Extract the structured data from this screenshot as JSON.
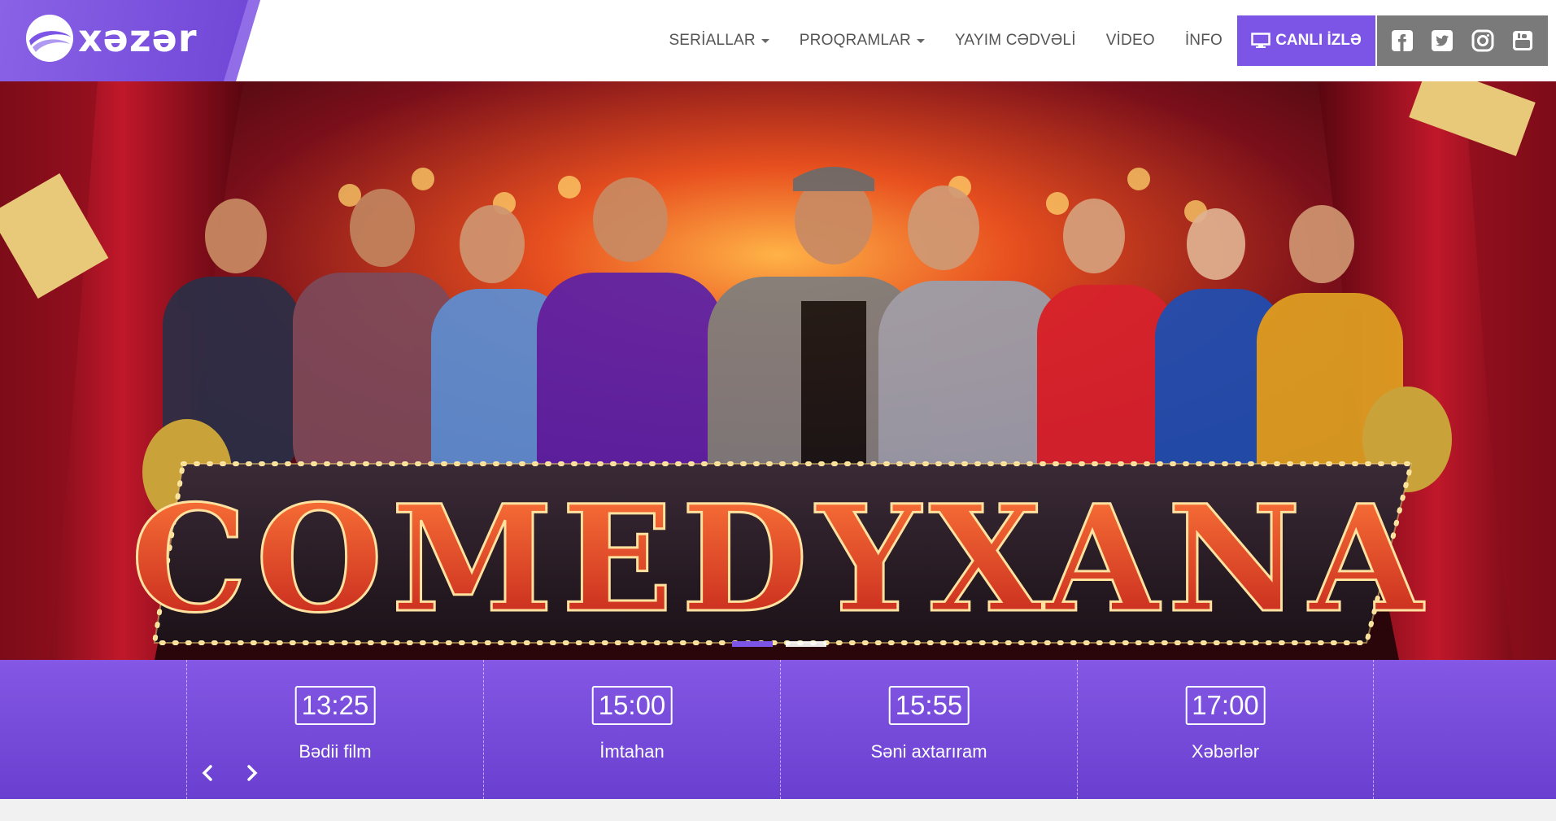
{
  "brand": {
    "name": "xəzər",
    "logo_icon": "xezer-logo-icon",
    "primary_color": "#7c55e6"
  },
  "nav": {
    "items": [
      {
        "label": "SERİALLAR",
        "dropdown": true
      },
      {
        "label": "PROQRAMLAR",
        "dropdown": true
      },
      {
        "label": "YAYIM CƏDVƏLİ",
        "dropdown": false
      },
      {
        "label": "VİDEO",
        "dropdown": false
      },
      {
        "label": "İNFO",
        "dropdown": false
      }
    ],
    "live_button": "CANLI İZLƏ",
    "social": [
      "facebook-icon",
      "twitter-icon",
      "instagram-icon",
      "youtube-icon"
    ]
  },
  "hero": {
    "title": "COMEDYXANA",
    "slides_total": 2,
    "active_slide": 1
  },
  "schedule": {
    "items": [
      {
        "time": "13:25",
        "title": "Bədii film"
      },
      {
        "time": "15:00",
        "title": "İmtahan"
      },
      {
        "time": "15:55",
        "title": "Səni axtarıram"
      },
      {
        "time": "17:00",
        "title": "Xəbərlər"
      }
    ]
  }
}
